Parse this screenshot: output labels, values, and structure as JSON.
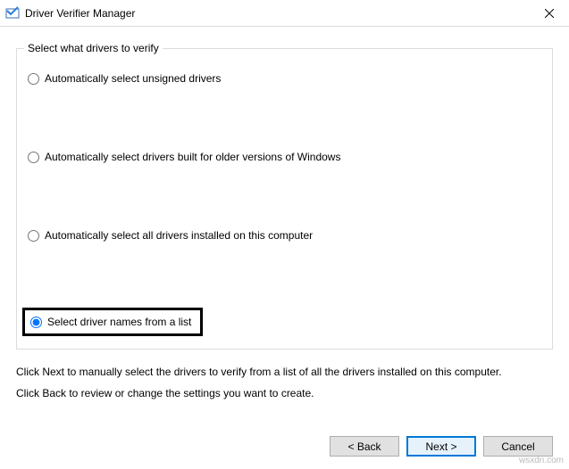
{
  "window": {
    "title": "Driver Verifier Manager"
  },
  "group": {
    "legend": "Select what drivers to verify",
    "options": {
      "opt1": "Automatically select unsigned drivers",
      "opt2": "Automatically select drivers built for older versions of Windows",
      "opt3": "Automatically select all drivers installed on this computer",
      "opt4": "Select driver names from a list"
    },
    "selected": "opt4"
  },
  "help": {
    "line1": "Click Next to manually select the drivers to verify from a list of all the drivers installed on this computer.",
    "line2": "Click Back to review or change the settings you want to create."
  },
  "buttons": {
    "back": "< Back",
    "next": "Next >",
    "cancel": "Cancel"
  },
  "watermark": "wsxdn.com"
}
